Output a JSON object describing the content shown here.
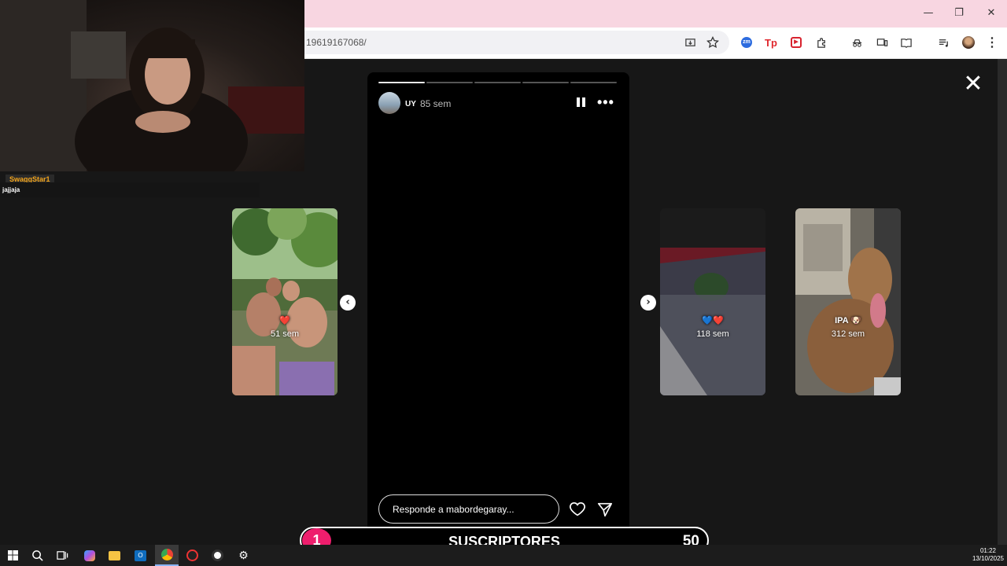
{
  "browser": {
    "url": "19619167068/",
    "window_controls": {
      "minimize": "—",
      "restore": "❐",
      "close": "✕"
    }
  },
  "story": {
    "username": "UY",
    "time": "85 sem",
    "progress_segments": 5,
    "active_segment": 0,
    "reply_placeholder": "Responde a mabordegaray...",
    "more_label": "•••",
    "close_label": "✕"
  },
  "previews": [
    {
      "label": "51 sem",
      "emoji": "❤️"
    },
    {
      "label": "118 sem",
      "emoji": "💙❤️"
    },
    {
      "label": "312 sem",
      "title": "IPA 🐶"
    }
  ],
  "nav": {
    "prev": "‹",
    "next": "›"
  },
  "overlay": {
    "chat_username": "SwaggStar1",
    "chat_message": "jajjaja"
  },
  "subscribers": {
    "badge": "1",
    "title": "SUSCRIPTORES",
    "count": "50"
  },
  "taskbar": {
    "time": "01:22",
    "date": "13/10/2025"
  },
  "colors": {
    "titlebar": "#f8d6e1",
    "badge": "#ee1e6d",
    "chat_name": "#f3a51c"
  }
}
